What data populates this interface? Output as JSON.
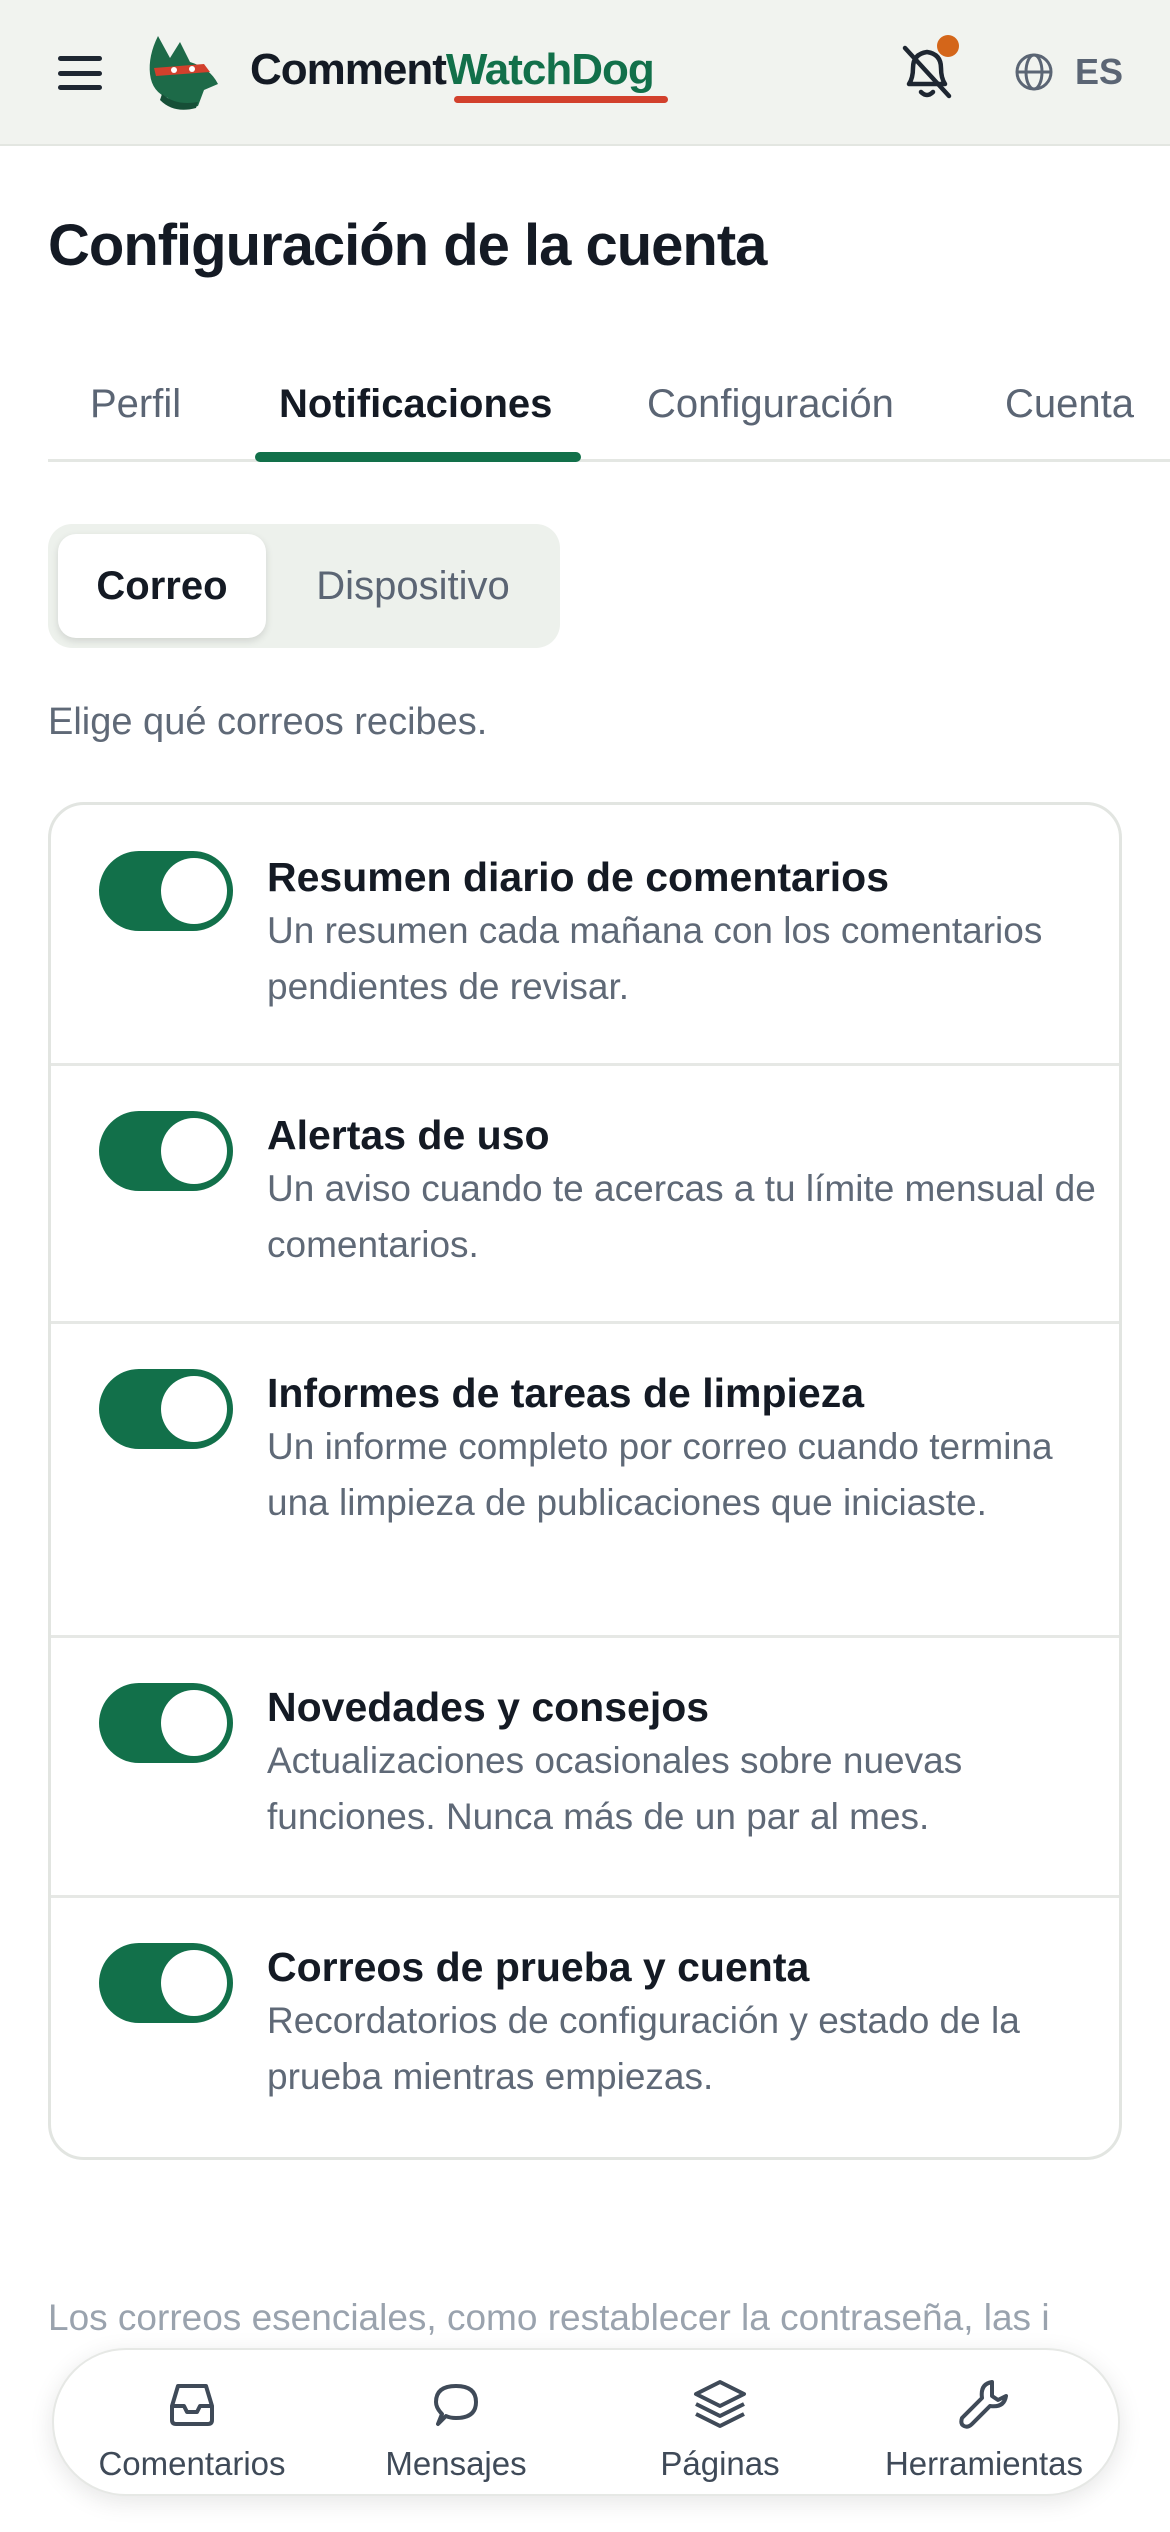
{
  "header": {
    "brand_part1": "Comment",
    "brand_part2": "WatchDog",
    "language": "ES",
    "icons": {
      "menu": "menu-icon",
      "logo": "dog-logo-icon",
      "notifications": "bell-icon",
      "language": "globe-icon"
    },
    "colors": {
      "brand_green": "#12704a",
      "underline_red": "#d2402c",
      "notification_dot": "#d4661a"
    }
  },
  "page": {
    "title": "Configuración de la cuenta"
  },
  "tabs": [
    {
      "label": "Perfil",
      "active": false
    },
    {
      "label": "Notificaciones",
      "active": true
    },
    {
      "label": "Configuración",
      "active": false
    },
    {
      "label": "Cuenta",
      "active": false
    }
  ],
  "segmented": {
    "options": [
      "Correo",
      "Dispositivo"
    ],
    "selected": "Correo"
  },
  "intro": "Elige qué correos recibes.",
  "settings": [
    {
      "title": "Resumen diario de comentarios",
      "desc": "Un resumen cada mañana con los comentarios pendientes de revisar.",
      "enabled": true
    },
    {
      "title": "Alertas de uso",
      "desc": "Un aviso cuando te acercas a tu límite mensual de comentarios.",
      "enabled": true
    },
    {
      "title": "Informes de tareas de limpieza",
      "desc": "Un informe completo por correo cuando termina una limpieza de publicaciones que iniciaste.",
      "enabled": true
    },
    {
      "title": "Novedades y consejos",
      "desc": "Actualizaciones ocasionales sobre nuevas funciones. Nunca más de un par al mes.",
      "enabled": true
    },
    {
      "title": "Correos de prueba y cuenta",
      "desc": "Recordatorios de configuración y estado de la prueba mientras empiezas.",
      "enabled": true
    }
  ],
  "footnote": "Los correos esenciales, como restablecer la contraseña, las i",
  "bottom_nav": [
    {
      "label": "Comentarios",
      "icon": "inbox-icon"
    },
    {
      "label": "Mensajes",
      "icon": "chat-bubble-icon"
    },
    {
      "label": "Páginas",
      "icon": "layers-icon"
    },
    {
      "label": "Herramientas",
      "icon": "wrench-icon"
    }
  ]
}
